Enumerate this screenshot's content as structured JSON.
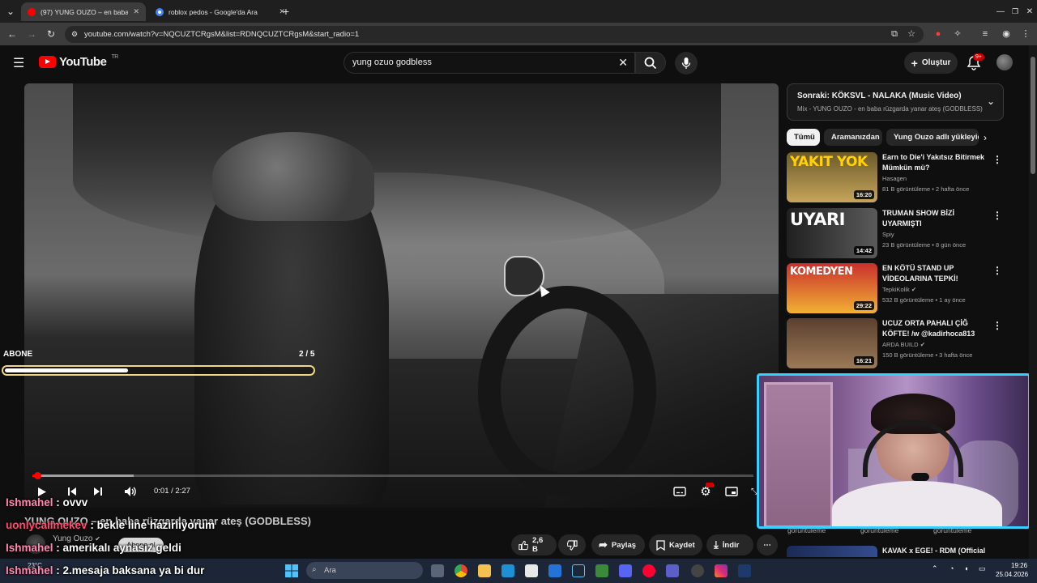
{
  "browser": {
    "tabs": [
      {
        "title": "(97) YUNG OUZO – en baba rüz",
        "active": true,
        "favicon_color": "#ff0000"
      },
      {
        "title": "roblox pedos - Google'da Ara",
        "active": false,
        "favicon_color": "#4285f4"
      }
    ],
    "new_tab": "+",
    "url": "youtube.com/watch?v=NQCUZTCRgsM&list=RDNQCUZTCRgsM&start_radio=1"
  },
  "youtube": {
    "logo_text": "YouTube",
    "country_code": "TR",
    "search_value": "yung ozuo godbless",
    "create_label": "Oluştur",
    "notification_count": "9+"
  },
  "player": {
    "time_current": "0:01",
    "time_total": "2:27",
    "time_display": "0:01 / 2:27",
    "played_fraction": 0.007,
    "buffered_fraction": 0.14
  },
  "overlay": {
    "subgoal_label": "ABONE",
    "subgoal_count": "2 / 5",
    "subgoal_fraction": 0.4
  },
  "video_info": {
    "title": "YUNG OUZO – en baba rüzgarda yanar ateş (GODBLESS)",
    "channel": "Yung Ouzo",
    "subscribe_label": "Abone ol",
    "like_count": "2,6 B",
    "share_label": "Paylaş",
    "save_label": "Kaydet",
    "download_label": "İndir"
  },
  "chat": [
    {
      "user": "Ishmahel",
      "message": "ovvv",
      "user_color": "#ff7aa6"
    },
    {
      "user": "uonlycallmekev",
      "message": "bekle line hazırlıyorum",
      "user_color": "#ff4d6d"
    },
    {
      "user": "Ishmahel",
      "message": "amerikalı aynasız geldi",
      "user_color": "#ff7aa6"
    },
    {
      "user": "Ishmahel",
      "message": "2.mesaja baksana ya bi dur",
      "user_color": "#ff7aa6"
    }
  ],
  "up_next": {
    "title": "Sonraki: KÖKSVL - NALAKA (Music Video)",
    "subtitle": "Mix - YUNG OUZO - en baba rüzgarda yanar ateş (GODBLESS)"
  },
  "chips": [
    "Tümü",
    "Aramanızdan",
    "Yung Ouzo adlı yükleyici"
  ],
  "recommendations": [
    {
      "title": "Earn to Die'i Yakıtsız Bitirmek Mümkün mü?",
      "channel": "Hasagen",
      "verified": false,
      "meta": "81 B görüntüleme • 2 hafta önce",
      "duration": "16:20",
      "thumb_text": "YAKIT YOK",
      "thumb_colors": [
        "#6b5a2c",
        "#c7a55a"
      ]
    },
    {
      "title": "TRUMAN SHOW BİZİ UYARMIŞTI",
      "channel": "Spiy",
      "verified": false,
      "meta": "23 B görüntüleme • 8 gün önce",
      "duration": "14:42",
      "thumb_text": "UYARI",
      "thumb_colors": [
        "#202020",
        "#5a5a5a"
      ]
    },
    {
      "title": "EN KÖTÜ STAND UP VİDEOLARINA TEPKİ!",
      "channel": "TepkiKolik",
      "verified": true,
      "meta": "532 B görüntüleme • 1 ay önce",
      "duration": "29:22",
      "thumb_text": "KOMEDYEN",
      "thumb_colors": [
        "#c9302c",
        "#f2b134"
      ]
    },
    {
      "title": "UCUZ ORTA PAHALI ÇİĞ KÖFTE! /w @kadirhoca813",
      "channel": "ARDA BUILD",
      "verified": true,
      "meta": "150 B görüntüleme • 3 hafta önce",
      "duration": "16:21",
      "thumb_text": "",
      "thumb_colors": [
        "#5a4030",
        "#9b7a56"
      ]
    }
  ],
  "partial_meta": [
    "görüntüleme",
    "görüntüleme",
    "görüntüleme"
  ],
  "rec5_title": "KAVAK x EGE! - RDM (Official",
  "taskbar": {
    "search_placeholder": "Ara",
    "weather": "23°C",
    "time": "19:26",
    "date": "25.04.2026"
  }
}
